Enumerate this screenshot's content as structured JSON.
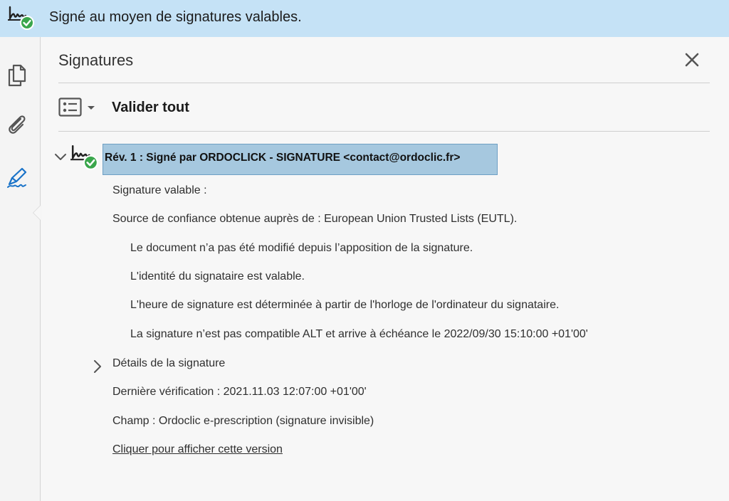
{
  "banner": {
    "text": "Signé au moyen de signatures valables.",
    "icon": "signature-valid-icon"
  },
  "rail": {
    "items": [
      {
        "name": "pages-icon",
        "selected": false
      },
      {
        "name": "attachments-icon",
        "selected": false
      },
      {
        "name": "signatures-icon",
        "selected": true
      }
    ]
  },
  "panel": {
    "title": "Signatures",
    "validate_all_label": "Valider tout",
    "revision": {
      "label": "Rév. 1 : Signé par ORDOCLICK - SIGNATURE <contact@ordoclic.fr>",
      "expanded": true,
      "lines": [
        "Signature valable :",
        "Source de confiance obtenue auprès de : European Union Trusted Lists (EUTL).",
        "Le document n’a pas été modifié depuis l’apposition de la signature.",
        "L'identité du signataire est valable.",
        "L'heure de signature est déterminée à partir de l'horloge de l'ordinateur du signataire.",
        "La signature n’est pas compatible ALT et arrive à échéance le 2022/09/30 15:10:00 +01'00'"
      ],
      "details_label": "Détails de la signature",
      "last_check": "Dernière vérification : 2021.11.03 12:07:00 +01'00'",
      "field": "Champ : Ordoclic e-prescription (signature invisible)",
      "view_version_link": "Cliquer pour afficher cette version"
    }
  },
  "colors": {
    "banner_bg": "#c5e2f6",
    "selection_bg": "#a6c8df",
    "accent_blue": "#1a73c8",
    "valid_green": "#3aa64c"
  }
}
